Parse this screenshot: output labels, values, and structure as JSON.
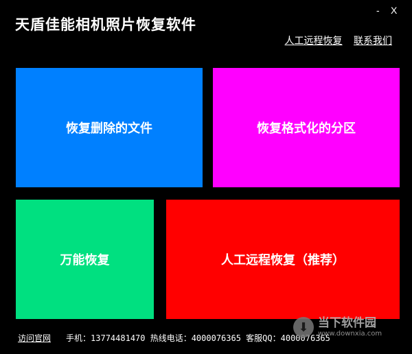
{
  "window": {
    "title": "天盾佳能相机照片恢复软件",
    "min_label": "-",
    "close_label": "X"
  },
  "header_links": [
    {
      "label": "人工远程恢复"
    },
    {
      "label": "联系我们"
    }
  ],
  "tiles": [
    {
      "label": "恢复删除的文件",
      "color": "#0080ff"
    },
    {
      "label": "恢复格式化的分区",
      "color": "#ff00ff"
    },
    {
      "label": "万能恢复",
      "color": "#00e080"
    },
    {
      "label": "人工远程恢复（推荐）",
      "color": "#ff0000"
    }
  ],
  "footer": {
    "visit_label": "访问官网",
    "contact_text": "手机：13774481470 热线电话：4000076365 客服QQ：4000076365"
  },
  "watermark": {
    "icon": "download-arrow-icon",
    "name": "当下软件园",
    "url": "www.downxia.com"
  }
}
